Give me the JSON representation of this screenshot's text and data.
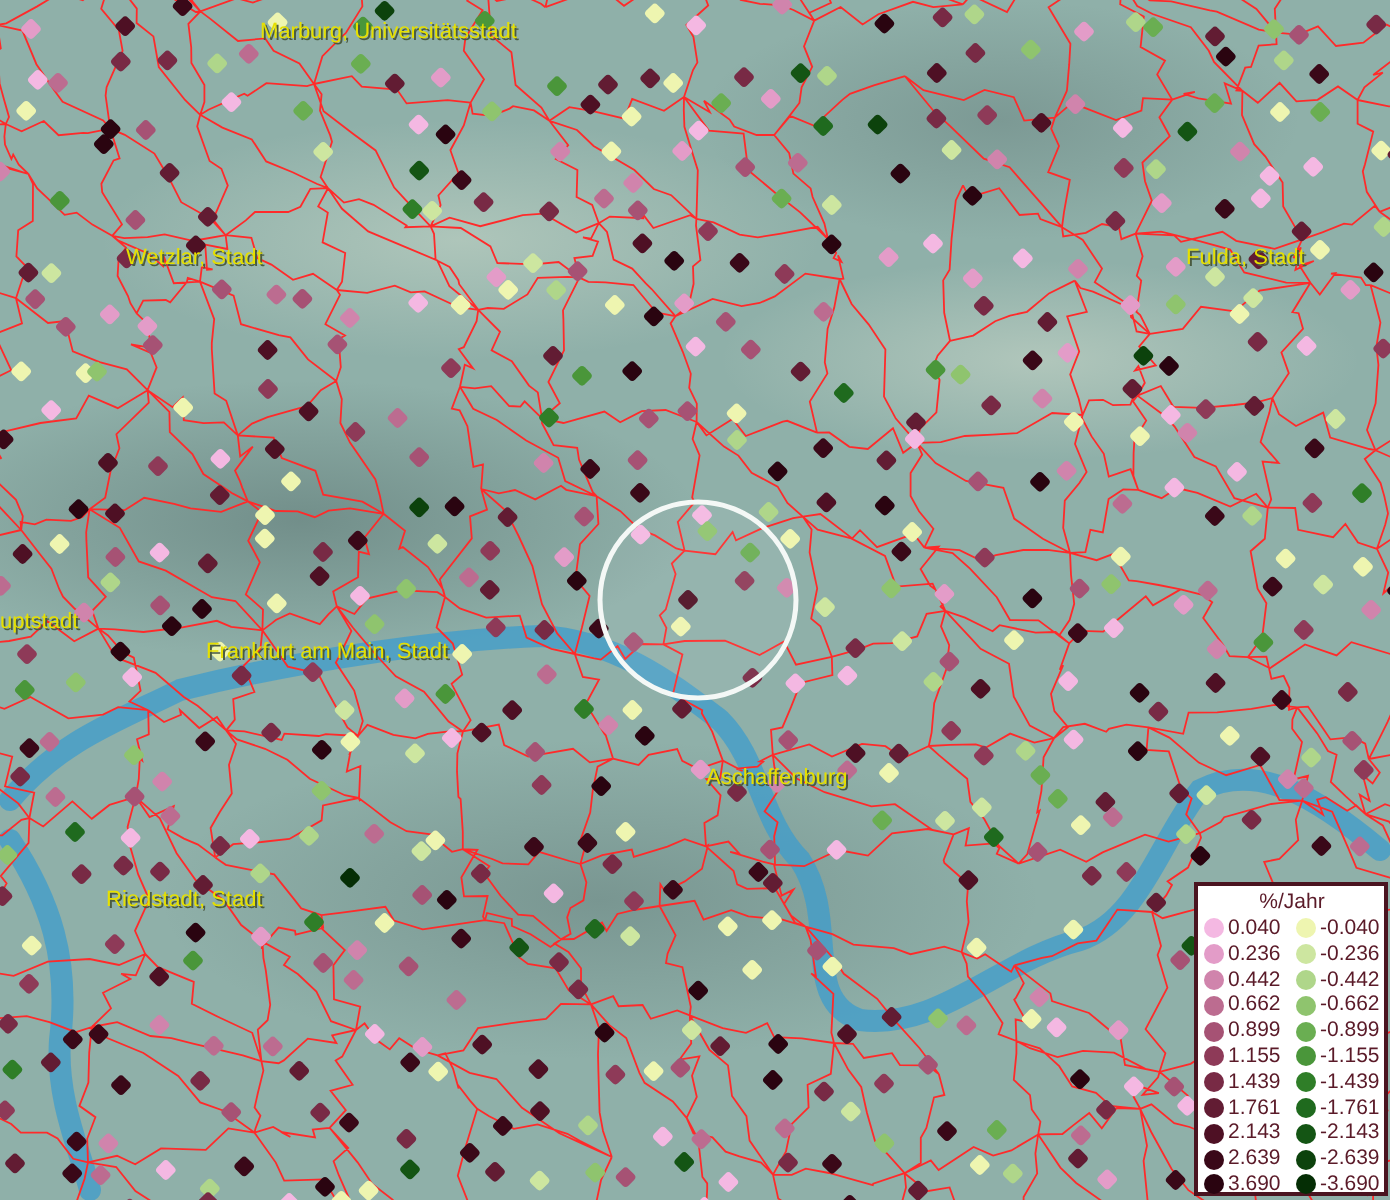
{
  "map": {
    "place_labels": [
      {
        "text": "Marburg, Universitätsstadt"
      },
      {
        "text": "Wetzlar, Stadt"
      },
      {
        "text": "Fulda, Stadt"
      },
      {
        "text": "uptstadt"
      },
      {
        "text": "Frankfurt am Main, Stadt"
      },
      {
        "text": "Aschaffenburg"
      },
      {
        "text": "Riedstadt, Stadt"
      }
    ]
  },
  "legend": {
    "title": "%/Jahr",
    "classes": [
      {
        "positive": {
          "label": "0.040",
          "color": "#f4b8e2"
        },
        "negative": {
          "label": "-0.040",
          "color": "#eef5b0"
        }
      },
      {
        "positive": {
          "label": "0.236",
          "color": "#e39cc8"
        },
        "negative": {
          "label": "-0.236",
          "color": "#cde6a0"
        }
      },
      {
        "positive": {
          "label": "0.442",
          "color": "#d084ac"
        },
        "negative": {
          "label": "-0.442",
          "color": "#afd68a"
        }
      },
      {
        "positive": {
          "label": "0.662",
          "color": "#bc6c90"
        },
        "negative": {
          "label": "-0.662",
          "color": "#8fc46e"
        }
      },
      {
        "positive": {
          "label": "0.899",
          "color": "#a65274"
        },
        "negative": {
          "label": "-0.899",
          "color": "#6aae52"
        }
      },
      {
        "positive": {
          "label": "1.155",
          "color": "#8e3a58"
        },
        "negative": {
          "label": "-1.155",
          "color": "#4a963a"
        }
      },
      {
        "positive": {
          "label": "1.439",
          "color": "#782a45"
        },
        "negative": {
          "label": "-1.439",
          "color": "#2f7e28"
        }
      },
      {
        "positive": {
          "label": "1.761",
          "color": "#621c33"
        },
        "negative": {
          "label": "-1.761",
          "color": "#1f6a1e"
        }
      },
      {
        "positive": {
          "label": "2.143",
          "color": "#4e1024"
        },
        "negative": {
          "label": "-2.143",
          "color": "#145514"
        }
      },
      {
        "positive": {
          "label": "2.639",
          "color": "#3a0818"
        },
        "negative": {
          "label": "-2.639",
          "color": "#0c420c"
        }
      },
      {
        "positive": {
          "label": "3.690",
          "color": "#2a0410"
        },
        "negative": {
          "label": "-3.690",
          "color": "#052e05"
        }
      }
    ]
  }
}
